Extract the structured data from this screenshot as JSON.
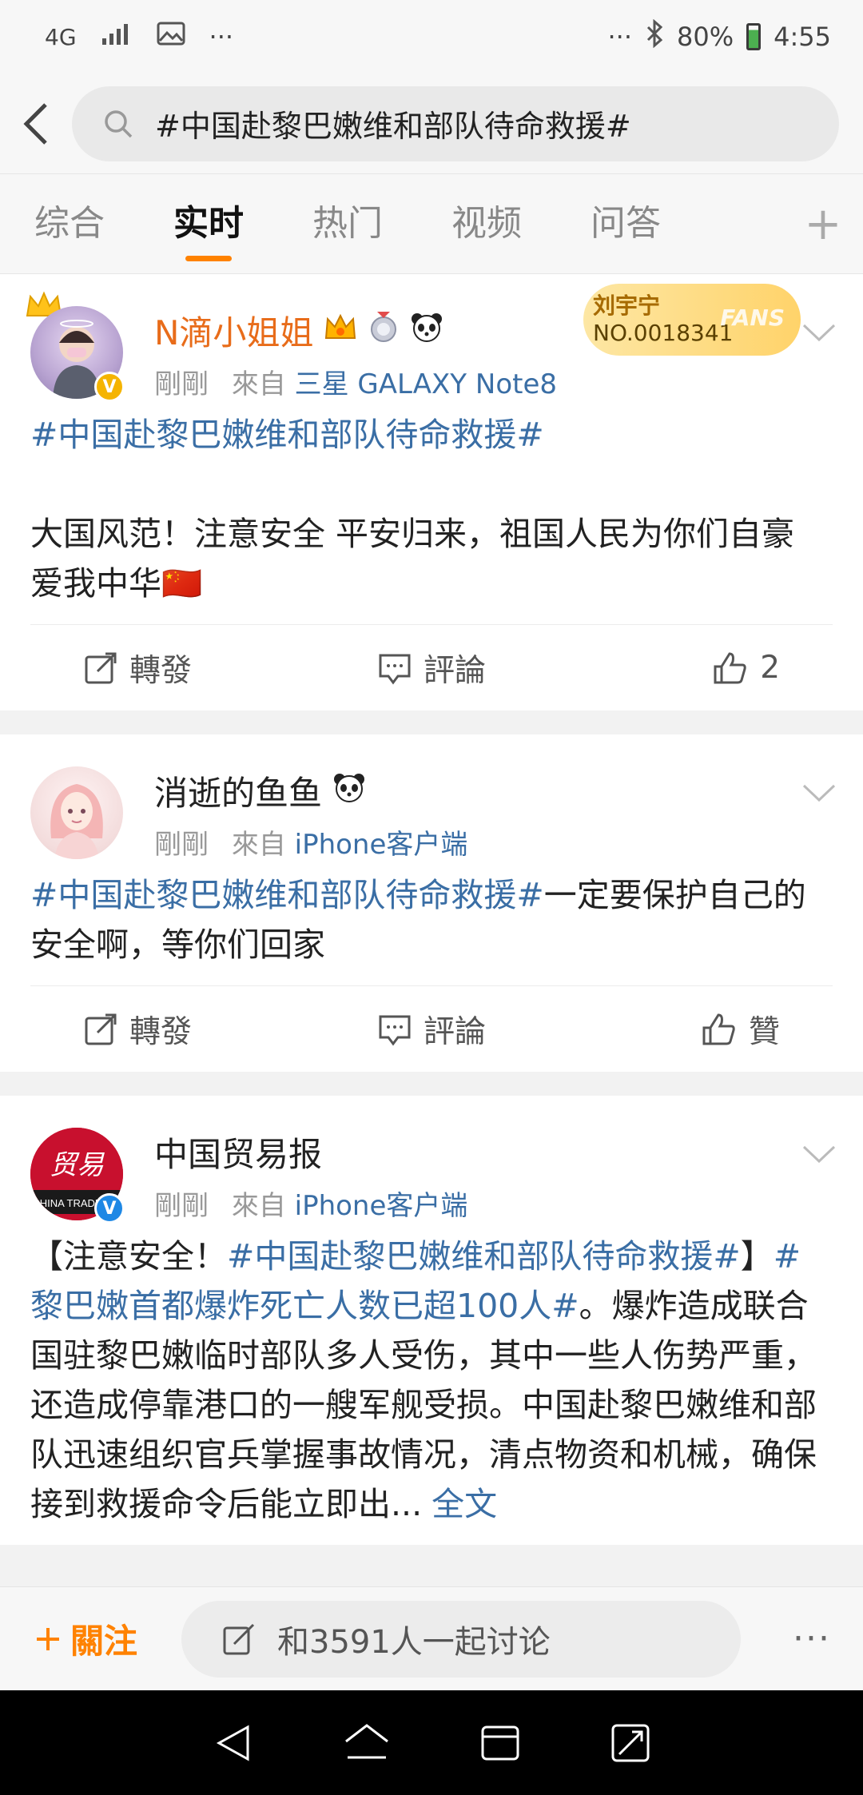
{
  "status_bar": {
    "network": "4G",
    "dots_left": "···",
    "dots_right": "···",
    "battery": "80%",
    "time": "4:55"
  },
  "search": {
    "query": "#中国赴黎巴嫩维和部队待命救援#"
  },
  "tabs": [
    {
      "label": "综合"
    },
    {
      "label": "实时"
    },
    {
      "label": "热门"
    },
    {
      "label": "视频"
    },
    {
      "label": "问答"
    }
  ],
  "tab_plus": "+",
  "posts": [
    {
      "name": "N滴小姐姐",
      "time": "剛剛",
      "from": "來自",
      "source": "三星 GALAXY Note8",
      "fans_badge": {
        "name": "刘宇宁",
        "number": "NO.0018341",
        "tag": "FANS"
      },
      "tag": "#中国赴黎巴嫩维和部队待命救援#",
      "text": "大国风范！注意安全 平安归来，祖国人民为你们自豪 爱我中华🇨🇳",
      "repost": "轉發",
      "comment": "評論",
      "like": "2"
    },
    {
      "name": "消逝的鱼鱼",
      "time": "剛剛",
      "from": "來自",
      "source": "iPhone客户端",
      "tag": "#中国赴黎巴嫩维和部队待命救援#",
      "text": "一定要保护自己的安全啊，等你们回家",
      "repost": "轉發",
      "comment": "評論",
      "like": "贊"
    },
    {
      "name": "中国贸易报",
      "time": "剛剛",
      "from": "來自",
      "source": "iPhone客户端",
      "avatar_text": "CHINA TRADE",
      "text_prefix": "【注意安全！",
      "tag": "#中国赴黎巴嫩维和部队待命救援#",
      "text_mid": "】",
      "tag2": "#黎巴嫩首都爆炸死亡人数已超100人#",
      "text": "。爆炸造成联合国驻黎巴嫩临时部队多人受伤，其中一些人伤势严重，还造成停靠港口的一艘军舰受损。中国赴黎巴嫩维和部队迅速组织官兵掌握事故情况，清点物资和机械，确保接到救援命令后能立即出...",
      "full_text": "全文"
    }
  ],
  "bottom": {
    "follow": "關注",
    "discuss": "和3591人一起讨论",
    "more": "···"
  },
  "colors": {
    "accent": "#ff8200",
    "link": "#3a6ea5"
  }
}
